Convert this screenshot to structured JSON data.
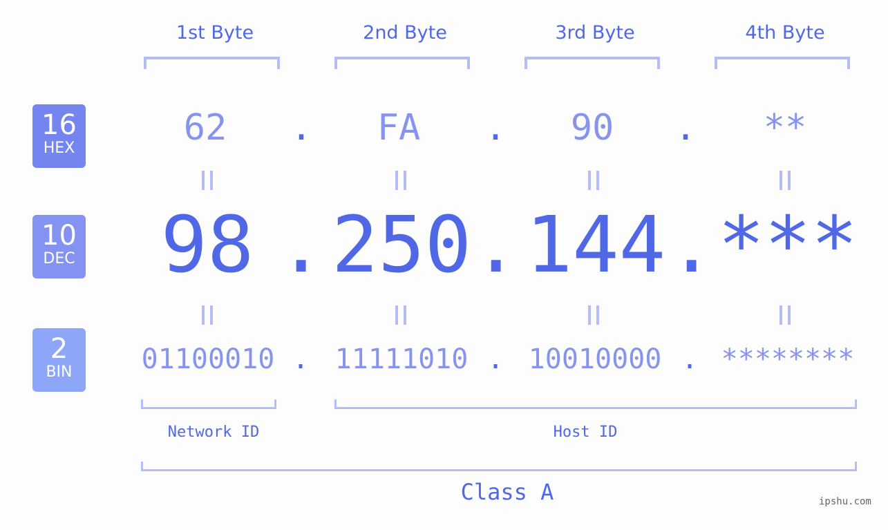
{
  "byte_headers": [
    "1st Byte",
    "2nd Byte",
    "3rd Byte",
    "4th Byte"
  ],
  "rows": {
    "hex": {
      "base": "16",
      "label": "HEX",
      "color": "#7585ef",
      "values": [
        "62",
        "FA",
        "90",
        "**"
      ]
    },
    "dec": {
      "base": "10",
      "label": "DEC",
      "color": "#8492f2",
      "values": [
        "98",
        "250",
        "144",
        "***"
      ]
    },
    "bin": {
      "base": "2",
      "label": "BIN",
      "color": "#8da6f8",
      "values": [
        "01100010",
        "11111010",
        "10010000",
        "********"
      ]
    }
  },
  "separator": ".",
  "network_id_label": "Network ID",
  "host_id_label": "Host ID",
  "class_label": "Class A",
  "watermark": "ipshu.com",
  "colors": {
    "accent": "#5068e6",
    "light": "#8794ee",
    "bracket": "#b3bdf8"
  }
}
